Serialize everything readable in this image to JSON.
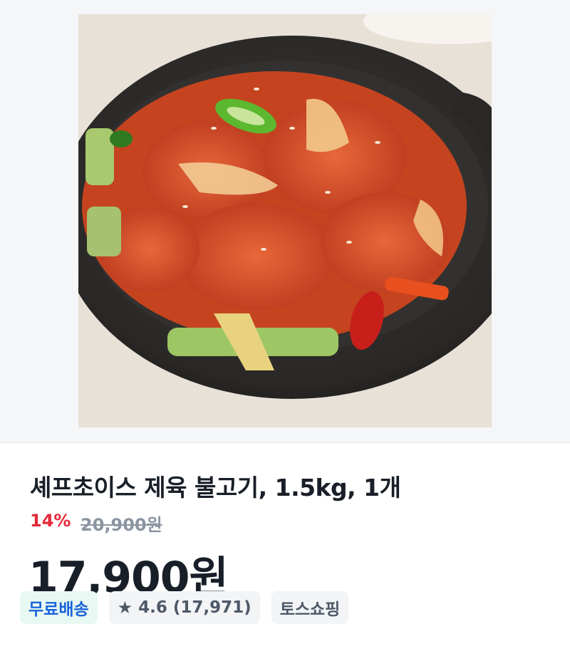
{
  "product": {
    "image_alt": "제육 불고기",
    "title": "셰프초이스 제육 불고기, 1.5kg, 1개",
    "discount_rate": "14%",
    "original_price": "20,900원",
    "price": "17,900원"
  },
  "badges": {
    "shipping": "무료배송",
    "rating_icon": "star-icon",
    "rating": "4.6",
    "review_count": "(17,971)",
    "seller": "토스쇼핑"
  },
  "colors": {
    "discount": "#e42939",
    "shipping_text": "#1b64da",
    "shipping_bg": "#e8f8f2",
    "neutral_badge_bg": "#f2f4f6"
  }
}
